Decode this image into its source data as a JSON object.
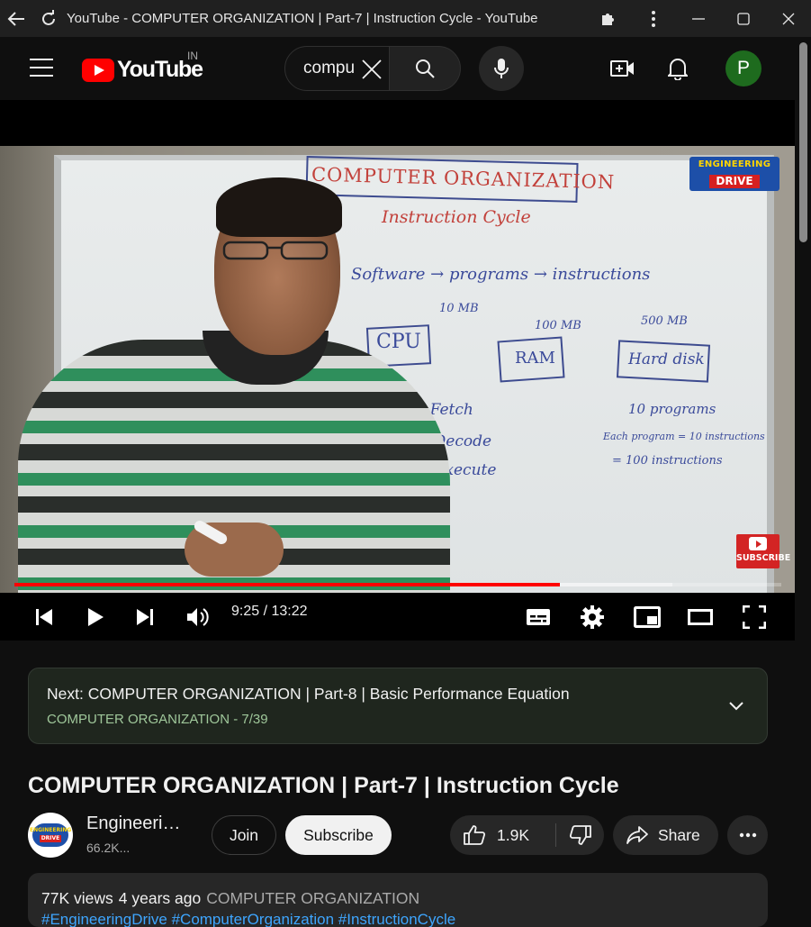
{
  "browser": {
    "title": "YouTube - COMPUTER ORGANIZATION | Part-7 | Instruction Cycle - YouTube",
    "icons": [
      "back-arrow-icon",
      "reload-icon",
      "extensions-icon",
      "more-vert-icon",
      "minimize-icon",
      "maximize-icon",
      "close-icon"
    ]
  },
  "header": {
    "logo_text": "YouTube",
    "region": "IN",
    "search": {
      "value": "compu"
    },
    "avatar_letter": "P",
    "brand_color": "#ff0000"
  },
  "video": {
    "whiteboard": {
      "title": "COMPUTER ORGANIZATION",
      "subtitle": "Instruction Cycle",
      "line1": "Software → programs → instructions",
      "cpu": "CPU",
      "ram": "RAM",
      "hdd": "Hard disk",
      "cpu_size": "10 MB",
      "ram_size": "100 MB",
      "hdd_size": "500 MB",
      "step1": "1. Fetch",
      "step2": "2. Decode",
      "step3": "Execute",
      "note1": "10 programs",
      "note2": "Each program = 10 instructions",
      "note3": "= 100 instructions"
    },
    "watermark": {
      "top": "ENGINEERING",
      "bottom": "DRIVE"
    },
    "subscribe_watermark": "SUBSCRIBE",
    "time": "9:25 / 13:22",
    "played_fraction": 0.711,
    "loaded_fraction": 0.858
  },
  "next_card": {
    "title": "Next: COMPUTER ORGANIZATION | Part-8 | Basic Performance Equation",
    "playlist": "COMPUTER ORGANIZATION - 7/39"
  },
  "meta": {
    "title": "COMPUTER ORGANIZATION | Part-7 | Instruction Cycle",
    "channel_name": "Engineering Drive",
    "channel_subs": "66.2K...",
    "join": "Join",
    "subscribe": "Subscribe",
    "likes": "1.9K",
    "share": "Share",
    "views": "77K views",
    "age": "4 years ago",
    "playlist": "COMPUTER ORGANIZATION",
    "tags": "#EngineeringDrive #ComputerOrganization #InstructionCycle"
  }
}
